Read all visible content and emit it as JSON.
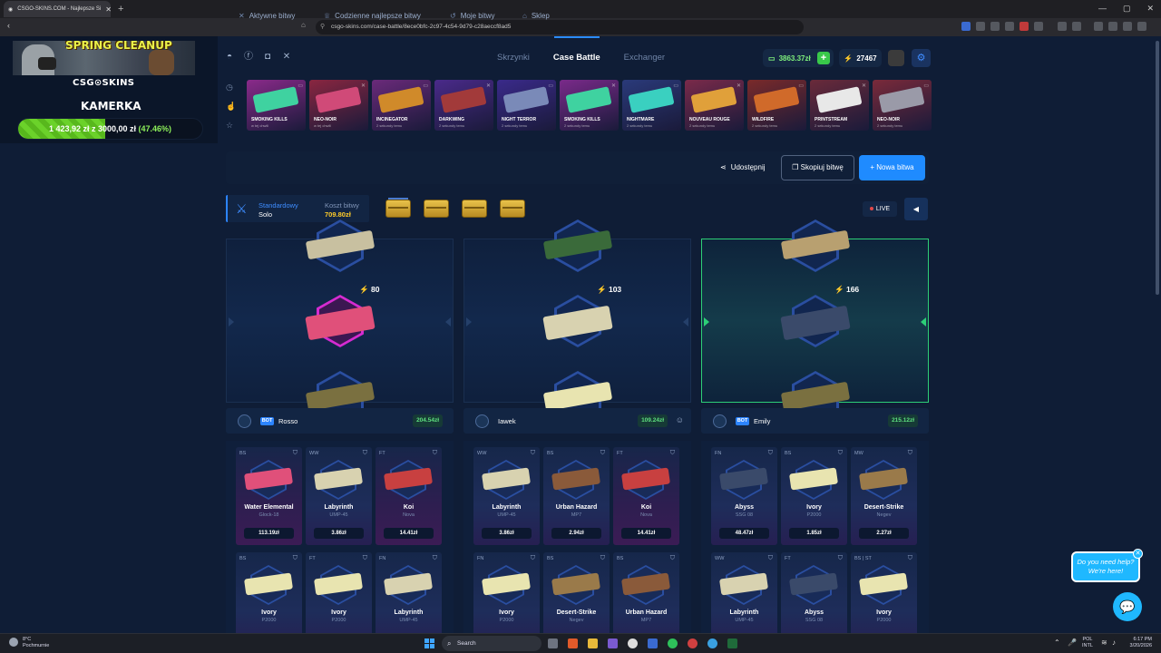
{
  "browser": {
    "tab_title": "CSGO-SKINS.COM - Najlepsze Si",
    "url": "csgo-skins.com/case-battle/8ece0bfc-2c97-4c54-9d79-c28aeccf8ad5"
  },
  "stream": {
    "banner": "SPRING CLEANUP",
    "logo": "CSG⊙SKINS",
    "title": "KAMERKA",
    "progress_text": "1 423,92 zł  z  3000,00 zł",
    "progress_pct_text": "(47.46%)",
    "progress_fraction": 0.4746
  },
  "header": {
    "nav": [
      "Skrzynki",
      "Case Battle",
      "Exchanger"
    ],
    "active_nav": "Case Battle",
    "balance": "3863.37zł",
    "coins": "27467"
  },
  "feed": [
    {
      "name": "SMOKING KILLS",
      "sub": "w tej chwili",
      "color": "#8a2a8a",
      "gun": "#3fd2a0"
    },
    {
      "name": "NEO-NOIR",
      "sub": "w tej chwili",
      "color": "#8a2640",
      "gun": "#d04a78"
    },
    {
      "name": "INCINEGATOR",
      "sub": "2 sekundy temu",
      "color": "#6a2a7a",
      "gun": "#d08a2a"
    },
    {
      "name": "DARKWING",
      "sub": "2 sekundy temu",
      "color": "#4a2a8a",
      "gun": "#a23a3a"
    },
    {
      "name": "NIGHT TERROR",
      "sub": "2 sekundy temu",
      "color": "#3a2a8a",
      "gun": "#7a8ab8"
    },
    {
      "name": "SMOKING KILLS",
      "sub": "2 sekundy temu",
      "color": "#7a2a8a",
      "gun": "#3fd2a0"
    },
    {
      "name": "NIGHTMARE",
      "sub": "2 sekundy temu",
      "color": "#2a3a7a",
      "gun": "#3ad0c0"
    },
    {
      "name": "NOUVEAU ROUGE",
      "sub": "2 sekundy temu",
      "color": "#7a2a4a",
      "gun": "#e0a03a"
    },
    {
      "name": "WILDFIRE",
      "sub": "2 sekundy temu",
      "color": "#7a2a2a",
      "gun": "#d06a2a"
    },
    {
      "name": "PRINTSTREAM",
      "sub": "2 sekundy temu",
      "color": "#6a2a3a",
      "gun": "#e8e8e8"
    },
    {
      "name": "NEO-NOIR",
      "sub": "2 sekundy temu",
      "color": "#7a2a3a",
      "gun": "#9a9aa8"
    }
  ],
  "subnav": {
    "items": [
      "Aktywne bitwy",
      "Codzienne najlepsze bitwy",
      "Moje bitwy",
      "Sklep"
    ],
    "share": "Udostępnij",
    "copy": "Skopiuj bitwę",
    "new": "+ Nowa bitwa"
  },
  "battle": {
    "mode": "Standardowy",
    "type": "Solo",
    "cost_label": "Koszt bitwy",
    "cost": "709.80zł",
    "live": "LIVE"
  },
  "players": [
    {
      "name": "Rosso",
      "bot": "BOT",
      "total": "204.54zł",
      "score": "80",
      "items": [
        {
          "cond": "BS",
          "skin": "Water Elemental",
          "weapon": "Glock-18",
          "price": "113.19zł",
          "red": true,
          "gun": "#e0507a"
        },
        {
          "cond": "WW",
          "skin": "Labyrinth",
          "weapon": "UMP-45",
          "price": "3.86zł",
          "red": false,
          "gun": "#d8d2b0"
        },
        {
          "cond": "FT",
          "skin": "Koi",
          "weapon": "Nova",
          "price": "14.41zł",
          "red": true,
          "gun": "#c84040"
        },
        {
          "cond": "BS",
          "skin": "Ivory",
          "weapon": "P2000",
          "price": "",
          "red": false,
          "gun": "#e8e4b0"
        },
        {
          "cond": "FT",
          "skin": "Ivory",
          "weapon": "P2000",
          "price": "",
          "red": false,
          "gun": "#e8e4b0"
        },
        {
          "cond": "FN",
          "skin": "Labyrinth",
          "weapon": "UMP-45",
          "price": "",
          "red": false,
          "gun": "#d8d2b0"
        }
      ]
    },
    {
      "name": "Iawek",
      "bot": "",
      "total": "109.24zł",
      "score": "103",
      "items": [
        {
          "cond": "WW",
          "skin": "Labyrinth",
          "weapon": "UMP-45",
          "price": "3.86zł",
          "red": false,
          "gun": "#d8d2b0"
        },
        {
          "cond": "BS",
          "skin": "Urban Hazard",
          "weapon": "MP7",
          "price": "2.94zł",
          "red": false,
          "gun": "#8a5a3a"
        },
        {
          "cond": "FT",
          "skin": "Koi",
          "weapon": "Nova",
          "price": "14.41zł",
          "red": true,
          "gun": "#c84040"
        },
        {
          "cond": "FN",
          "skin": "Ivory",
          "weapon": "P2000",
          "price": "",
          "red": false,
          "gun": "#e8e4b0"
        },
        {
          "cond": "BS",
          "skin": "Desert-Strike",
          "weapon": "Negev",
          "price": "",
          "red": false,
          "gun": "#9a7a4a"
        },
        {
          "cond": "BS",
          "skin": "Urban Hazard",
          "weapon": "MP7",
          "price": "",
          "red": false,
          "gun": "#8a5a3a"
        }
      ]
    },
    {
      "name": "Emily",
      "bot": "BOT",
      "total": "215.12zł",
      "score": "166",
      "items": [
        {
          "cond": "FN",
          "skin": "Abyss",
          "weapon": "SSG 08",
          "price": "48.47zł",
          "red": false,
          "gun": "#3a4a6a"
        },
        {
          "cond": "BS",
          "skin": "Ivory",
          "weapon": "P2000",
          "price": "1.85zł",
          "red": false,
          "gun": "#e8e4b0"
        },
        {
          "cond": "MW",
          "skin": "Desert-Strike",
          "weapon": "Negev",
          "price": "2.27zł",
          "red": false,
          "gun": "#9a7a4a"
        },
        {
          "cond": "WW",
          "skin": "Labyrinth",
          "weapon": "UMP-45",
          "price": "",
          "red": false,
          "gun": "#d8d2b0"
        },
        {
          "cond": "FT",
          "skin": "Abyss",
          "weapon": "SSG 08",
          "price": "",
          "red": false,
          "gun": "#3a4a6a"
        },
        {
          "cond": "BS | ST",
          "skin": "Ivory",
          "weapon": "P2000",
          "price": "",
          "red": false,
          "gun": "#e8e4b0"
        }
      ]
    }
  ],
  "help": {
    "line1": "Do you need help?",
    "line2": "We're here!"
  },
  "taskbar": {
    "weather_temp": "8°C",
    "weather_desc": "Pochmurnie",
    "search": "Search",
    "lang1": "POL",
    "lang2": "INTL",
    "time": "6:17 PM",
    "date": "3/20/2026"
  }
}
